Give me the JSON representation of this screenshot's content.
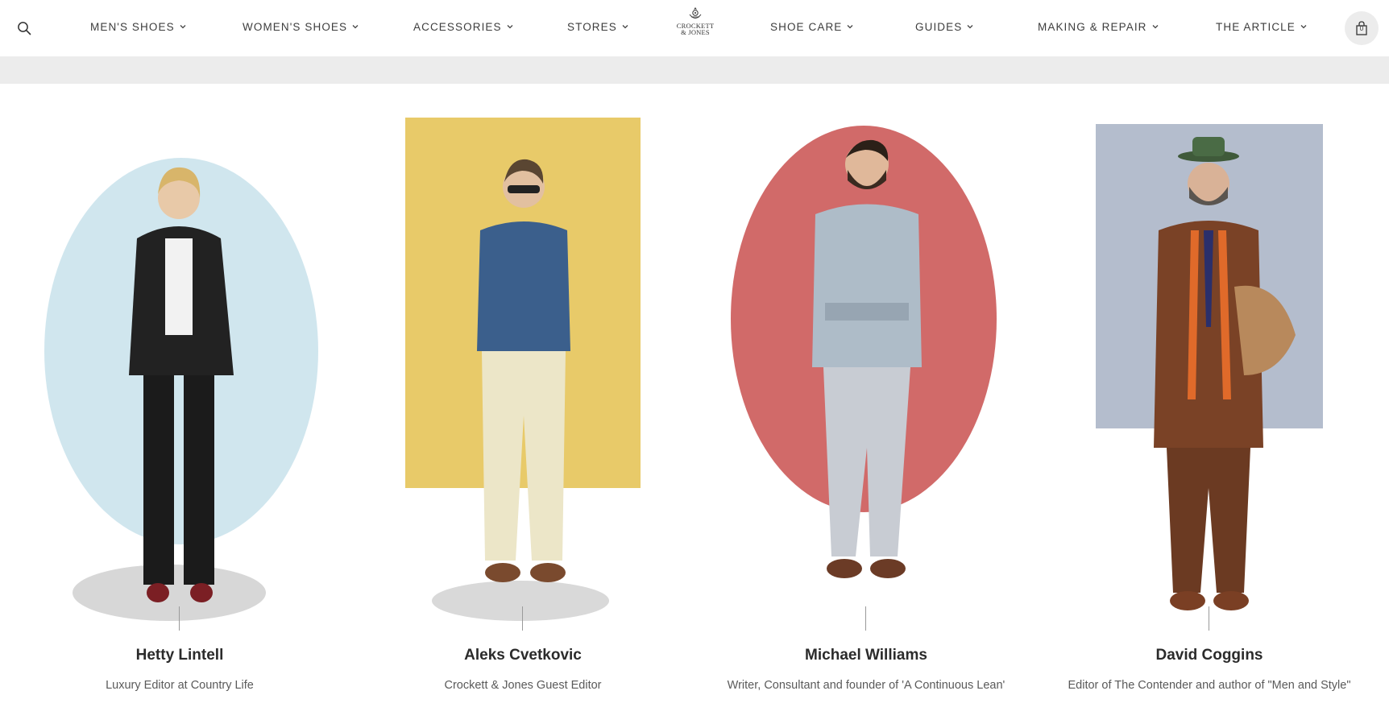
{
  "header": {
    "nav_left": [
      {
        "label": "MEN'S SHOES"
      },
      {
        "label": "WOMEN'S SHOES"
      },
      {
        "label": "ACCESSORIES"
      },
      {
        "label": "STORES"
      }
    ],
    "logo": {
      "line1": "CROCKETT",
      "line2": "& JONES"
    },
    "nav_right": [
      {
        "label": "SHOE CARE"
      },
      {
        "label": "GUIDES"
      },
      {
        "label": "MAKING & REPAIR"
      },
      {
        "label": "THE ARTICLE"
      }
    ],
    "bag_count": "0",
    "icons": {
      "search": "search-icon",
      "bag": "shopping-bag-icon",
      "chevron": "chevron-down-icon"
    }
  },
  "editors": [
    {
      "name": "Hetty Lintell",
      "role": "Luxury Editor at Country Life",
      "bg_color": "#a9d2e0",
      "outfit_color": "#222222"
    },
    {
      "name": "Aleks Cvetkovic",
      "role": "Crockett & Jones Guest Editor",
      "bg_color": "#e4c14f",
      "outfit_color": "#3b5f8c"
    },
    {
      "name": "Michael Williams",
      "role": "Writer, Consultant and founder of 'A Continuous Lean'",
      "bg_color": "#c9504f",
      "outfit_color": "#aebcc8"
    },
    {
      "name": "David Coggins",
      "role": "Editor of The Contender and author of \"Men and Style\"",
      "bg_color": "#a7b1c4",
      "outfit_color": "#7a4226"
    }
  ]
}
